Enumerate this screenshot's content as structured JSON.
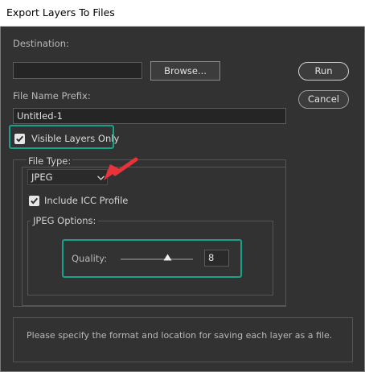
{
  "window": {
    "title": "Export Layers To Files"
  },
  "destination": {
    "label": "Destination:",
    "value": "",
    "browse_label": "Browse..."
  },
  "actions": {
    "run_label": "Run",
    "cancel_label": "Cancel"
  },
  "prefix": {
    "label": "File Name Prefix:",
    "value": "Untitled-1"
  },
  "visible_layers": {
    "label": "Visible Layers Only",
    "checked": true
  },
  "file_type": {
    "group_label": "File Type:",
    "selected": "JPEG",
    "icc_label": "Include ICC Profile",
    "icc_checked": true
  },
  "jpeg_options": {
    "group_label": "JPEG Options:",
    "quality_label": "Quality:",
    "quality_value": "8",
    "quality_min": 0,
    "quality_max": 12
  },
  "status": {
    "message": "Please specify the format and location for saving each layer as a file."
  },
  "colors": {
    "highlight": "#17a389",
    "arrow": "#e8333a",
    "background": "#323232"
  }
}
